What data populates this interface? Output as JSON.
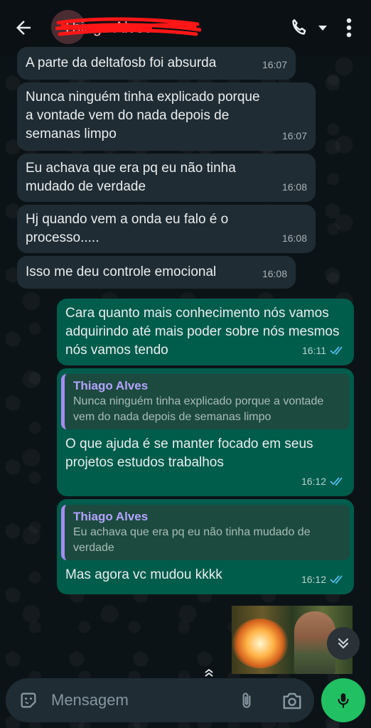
{
  "header": {
    "contact_name": "Thiago Alves",
    "icons": [
      "back-arrow-icon",
      "phone-icon",
      "caret-down-icon",
      "more-vertical-icon"
    ]
  },
  "messages": [
    {
      "direction": "in",
      "text": "A parte da deltafosb foi absurda",
      "time": "16:07"
    },
    {
      "direction": "in",
      "text": "Nunca ninguém tinha explicado porque a vontade vem do nada depois de semanas limpo",
      "time": "16:07"
    },
    {
      "direction": "in",
      "text": "Eu achava que era pq eu não tinha mudado de verdade",
      "time": "16:08"
    },
    {
      "direction": "in",
      "text": "Hj quando vem a onda eu falo é o processo.....",
      "time": "16:08"
    },
    {
      "direction": "in",
      "text": "Isso me deu controle emocional",
      "time": "16:08"
    },
    {
      "direction": "out",
      "text": "Cara quanto mais conhecimento nós vamos adquirindo até mais poder sobre nós mesmos nós vamos tendo",
      "time": "16:11",
      "status": "read"
    },
    {
      "direction": "out",
      "quote_author": "Thiago Alves",
      "quote_text": "Nunca ninguém tinha explicado porque a vontade vem do nada depois de semanas limpo",
      "text": "O que ajuda é se manter focado em seus projetos estudos trabalhos",
      "time": "16:12",
      "status": "read"
    },
    {
      "direction": "out",
      "quote_author": "Thiago Alves",
      "quote_text": "Eu achava que era pq eu não tinha mudado de verdade",
      "text": "Mas agora vc mudou kkkk",
      "time": "16:12",
      "status": "read"
    }
  ],
  "composer": {
    "placeholder": "Mensagem"
  },
  "colors": {
    "incoming_bubble": "#202c33",
    "outgoing_bubble": "#005c4b",
    "read_ticks": "#53bdeb",
    "mic_button": "#21c063",
    "quote_accent": "#a58cf0"
  }
}
